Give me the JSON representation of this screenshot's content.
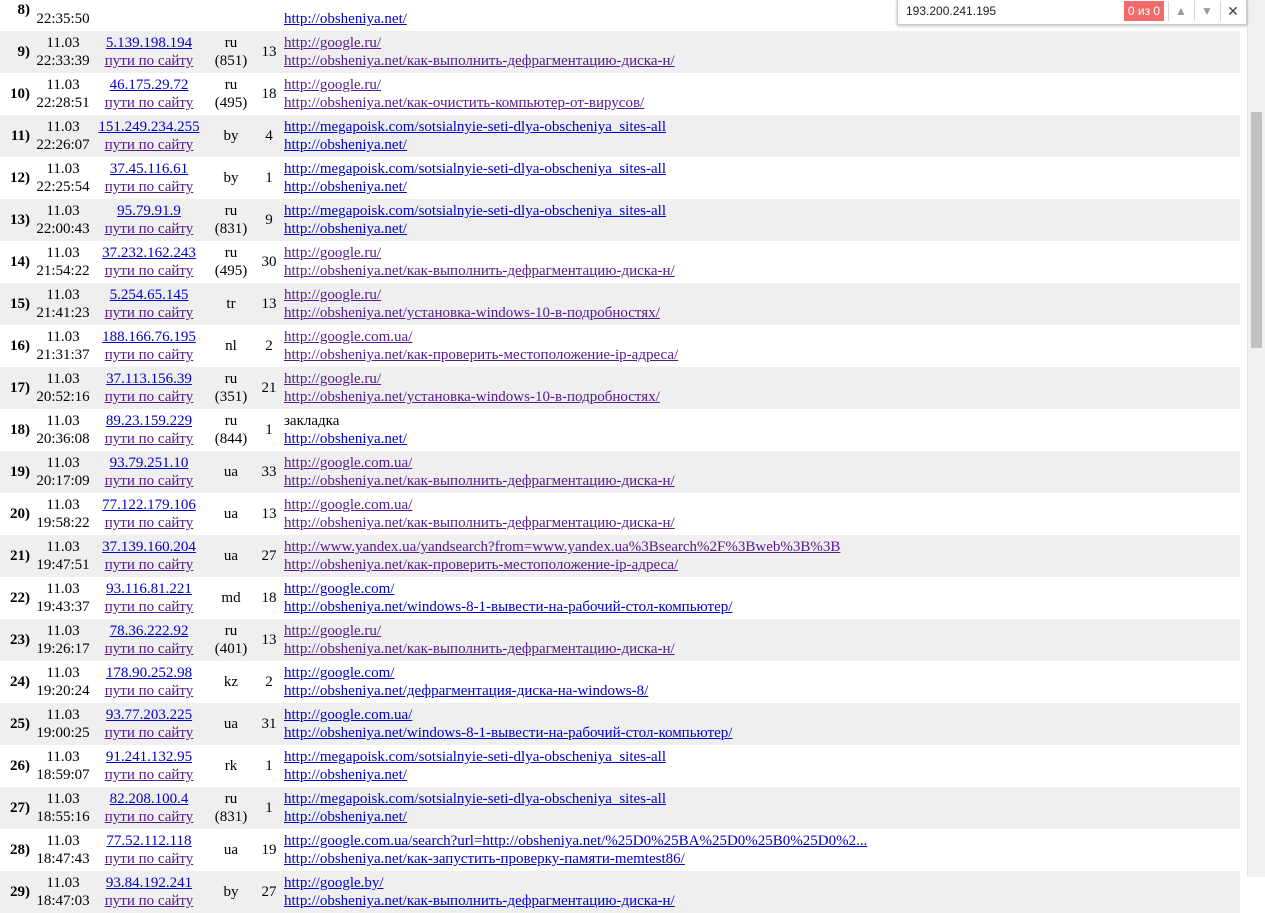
{
  "find": {
    "query": "193.200.241.195",
    "count": "0 из 0"
  },
  "rows": [
    {
      "n": "8)",
      "date": "",
      "time": "22:35:50",
      "ip": "",
      "path": "",
      "cc": "",
      "code": "",
      "hits": "",
      "ref": "",
      "page": "http://obsheniya.net/",
      "visited": false
    },
    {
      "n": "9)",
      "date": "11.03",
      "time": "22:33:39",
      "ip": "5.139.198.194",
      "path": "пути по сайту",
      "cc": "ru",
      "code": "(851)",
      "hits": "13",
      "ref": "http://google.ru/",
      "page": "http://obsheniya.net/как-выполнить-дефрагментацию-диска-н/",
      "visited": true
    },
    {
      "n": "10)",
      "date": "11.03",
      "time": "22:28:51",
      "ip": "46.175.29.72",
      "path": "пути по сайту",
      "cc": "ru",
      "code": "(495)",
      "hits": "18",
      "ref": "http://google.ru/",
      "page": "http://obsheniya.net/как-очистить-компьютер-от-вирусов/",
      "visited": true
    },
    {
      "n": "11)",
      "date": "11.03",
      "time": "22:26:07",
      "ip": "151.249.234.255",
      "path": "пути по сайту",
      "cc": "by",
      "code": "",
      "hits": "4",
      "ref": "http://megapoisk.com/sotsialnyie-seti-dlya-obscheniya_sites-all",
      "page": "http://obsheniya.net/",
      "visited": false
    },
    {
      "n": "12)",
      "date": "11.03",
      "time": "22:25:54",
      "ip": "37.45.116.61",
      "path": "пути по сайту",
      "cc": "by",
      "code": "",
      "hits": "1",
      "ref": "http://megapoisk.com/sotsialnyie-seti-dlya-obscheniya_sites-all",
      "page": "http://obsheniya.net/",
      "visited": false
    },
    {
      "n": "13)",
      "date": "11.03",
      "time": "22:00:43",
      "ip": "95.79.91.9",
      "path": "пути по сайту",
      "cc": "ru",
      "code": "(831)",
      "hits": "9",
      "ref": "http://megapoisk.com/sotsialnyie-seti-dlya-obscheniya_sites-all",
      "page": "http://obsheniya.net/",
      "visited": false
    },
    {
      "n": "14)",
      "date": "11.03",
      "time": "21:54:22",
      "ip": "37.232.162.243",
      "path": "пути по сайту",
      "cc": "ru",
      "code": "(495)",
      "hits": "30",
      "ref": "http://google.ru/",
      "page": "http://obsheniya.net/как-выполнить-дефрагментацию-диска-н/",
      "visited": true
    },
    {
      "n": "15)",
      "date": "11.03",
      "time": "21:41:23",
      "ip": "5.254.65.145",
      "path": "пути по сайту",
      "cc": "tr",
      "code": "",
      "hits": "13",
      "ref": "http://google.ru/",
      "page": "http://obsheniya.net/установка-windows-10-в-подробностях/",
      "visited": true
    },
    {
      "n": "16)",
      "date": "11.03",
      "time": "21:31:37",
      "ip": "188.166.76.195",
      "path": "пути по сайту",
      "cc": "nl",
      "code": "",
      "hits": "2",
      "ref": "http://google.com.ua/",
      "page": "http://obsheniya.net/как-проверить-местоположение-ip-адреса/",
      "visited": true
    },
    {
      "n": "17)",
      "date": "11.03",
      "time": "20:52:16",
      "ip": "37.113.156.39",
      "path": "пути по сайту",
      "cc": "ru",
      "code": "(351)",
      "hits": "21",
      "ref": "http://google.ru/",
      "page": "http://obsheniya.net/установка-windows-10-в-подробностях/",
      "visited": true
    },
    {
      "n": "18)",
      "date": "11.03",
      "time": "20:36:08",
      "ip": "89.23.159.229",
      "path": "пути по сайту",
      "cc": "ru",
      "code": "(844)",
      "hits": "1",
      "ref": "закладка",
      "page": "http://obsheniya.net/",
      "visited": false,
      "plainref": true
    },
    {
      "n": "19)",
      "date": "11.03",
      "time": "20:17:09",
      "ip": "93.79.251.10",
      "path": "пути по сайту",
      "cc": "ua",
      "code": "",
      "hits": "33",
      "ref": "http://google.com.ua/",
      "page": "http://obsheniya.net/как-выполнить-дефрагментацию-диска-н/",
      "visited": true
    },
    {
      "n": "20)",
      "date": "11.03",
      "time": "19:58:22",
      "ip": "77.122.179.106",
      "path": "пути по сайту",
      "cc": "ua",
      "code": "",
      "hits": "13",
      "ref": "http://google.com.ua/",
      "page": "http://obsheniya.net/как-выполнить-дефрагментацию-диска-н/",
      "visited": true
    },
    {
      "n": "21)",
      "date": "11.03",
      "time": "19:47:51",
      "ip": "37.139.160.204",
      "path": "пути по сайту",
      "cc": "ua",
      "code": "",
      "hits": "27",
      "ref": "http://www.yandex.ua/yandsearch?from=www.yandex.ua%3Bsearch%2F%3Bweb%3B%3B",
      "page": "http://obsheniya.net/как-проверить-местоположение-ip-адреса/",
      "visited": true
    },
    {
      "n": "22)",
      "date": "11.03",
      "time": "19:43:37",
      "ip": "93.116.81.221",
      "path": "пути по сайту",
      "cc": "md",
      "code": "",
      "hits": "18",
      "ref": "http://google.com/",
      "page": "http://obsheniya.net/windows-8-1-вывести-на-рабочий-стол-компьютер/",
      "visited": false
    },
    {
      "n": "23)",
      "date": "11.03",
      "time": "19:26:17",
      "ip": "78.36.222.92",
      "path": "пути по сайту",
      "cc": "ru",
      "code": "(401)",
      "hits": "13",
      "ref": "http://google.ru/",
      "page": "http://obsheniya.net/как-выполнить-дефрагментацию-диска-н/",
      "visited": true
    },
    {
      "n": "24)",
      "date": "11.03",
      "time": "19:20:24",
      "ip": "178.90.252.98",
      "path": "пути по сайту",
      "cc": "kz",
      "code": "",
      "hits": "2",
      "ref": "http://google.com/",
      "page": "http://obsheniya.net/дефрагментация-диска-на-windows-8/",
      "visited": false
    },
    {
      "n": "25)",
      "date": "11.03",
      "time": "19:00:25",
      "ip": "93.77.203.225",
      "path": "пути по сайту",
      "cc": "ua",
      "code": "",
      "hits": "31",
      "ref": "http://google.com.ua/",
      "page": "http://obsheniya.net/windows-8-1-вывести-на-рабочий-стол-компьютер/",
      "visited": false
    },
    {
      "n": "26)",
      "date": "11.03",
      "time": "18:59:07",
      "ip": "91.241.132.95",
      "path": "пути по сайту",
      "cc": "rk",
      "code": "",
      "hits": "1",
      "ref": "http://megapoisk.com/sotsialnyie-seti-dlya-obscheniya_sites-all",
      "page": "http://obsheniya.net/",
      "visited": false
    },
    {
      "n": "27)",
      "date": "11.03",
      "time": "18:55:16",
      "ip": "82.208.100.4",
      "path": "пути по сайту",
      "cc": "ru",
      "code": "(831)",
      "hits": "1",
      "ref": "http://megapoisk.com/sotsialnyie-seti-dlya-obscheniya_sites-all",
      "page": "http://obsheniya.net/",
      "visited": false
    },
    {
      "n": "28)",
      "date": "11.03",
      "time": "18:47:43",
      "ip": "77.52.112.118",
      "path": "пути по сайту",
      "cc": "ua",
      "code": "",
      "hits": "19",
      "ref": "http://google.com.ua/search?url=http://obsheniya.net/%25D0%25BA%25D0%25B0%25D0%2...",
      "page": "http://obsheniya.net/как-запустить-проверку-памяти-memtest86/",
      "visited": false
    },
    {
      "n": "29)",
      "date": "11.03",
      "time": "18:47:03",
      "ip": "93.84.192.241",
      "path": "пути по сайту",
      "cc": "by",
      "code": "",
      "hits": "27",
      "ref": "http://google.by/",
      "page": "http://obsheniya.net/как-выполнить-дефрагментацию-диска-н/",
      "visited": false
    }
  ]
}
